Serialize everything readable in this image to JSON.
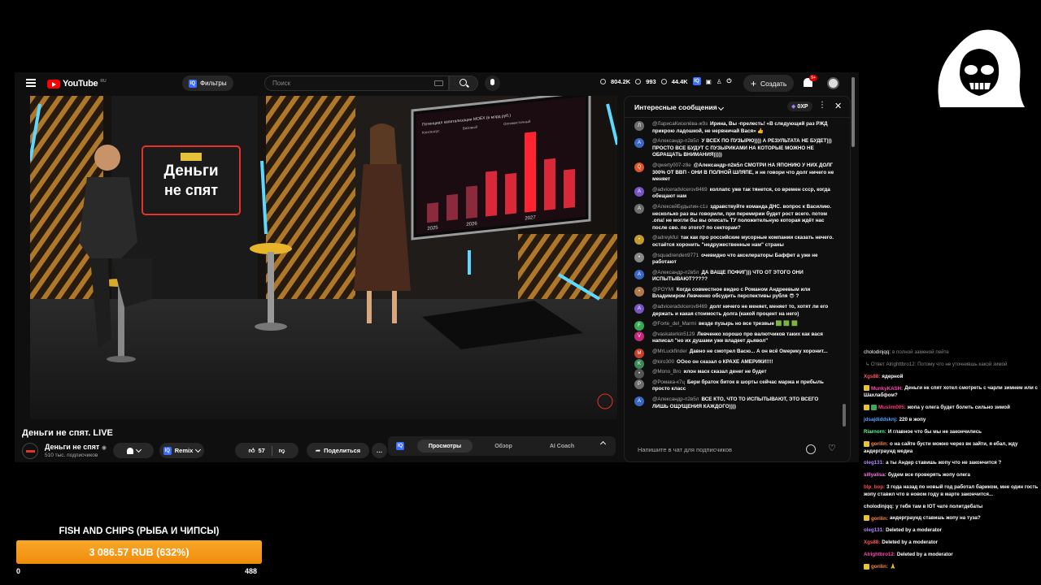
{
  "topbar": {
    "logo_text": "YouTube",
    "logo_country": "RU",
    "filter_label": "Фильтры",
    "search_placeholder": "Поиск",
    "stats": [
      "804.2K",
      "993",
      "44.4K"
    ],
    "create_label": "Создать",
    "notification_count": "9+"
  },
  "video": {
    "title": "Деньги не спят. LIVE",
    "studio_logo_line1": "Деньги",
    "studio_logo_line2": "не спят",
    "screen_chart_title": "Потенциал капитализации МОЕХ (в млрд руб.)",
    "screen_chart_legend": [
      "Консенсус",
      "Базовый",
      "Оптимистичный"
    ],
    "screen_chart": {
      "type": "bar",
      "categories": [
        "2025",
        "",
        "2026",
        "",
        "",
        "2027",
        "",
        ""
      ],
      "values": [
        18,
        24,
        30,
        42,
        38,
        75,
        48,
        36
      ]
    }
  },
  "channel": {
    "name": "Деньги не спят",
    "subscribers": "510 тыс. подписчиков",
    "remix_label": "Remix",
    "likes": "57",
    "share_label": "Поделиться"
  },
  "side_tabs": [
    "Просмотры",
    "Обзор",
    "AI Coach"
  ],
  "chat": {
    "header_title": "Интересные сообщения",
    "points": "0XP",
    "input_placeholder": "Напишите в чат для подписчиков",
    "messages": [
      {
        "initial": "Л",
        "color": "#6d6d6d",
        "author": "@ЛарисаКиселёва-ж9з",
        "text": "Ирина, Вы -прелесть! «В следующий раз РЖД прикрою ладошкой, не нервничай Вася» 👍"
      },
      {
        "initial": "А",
        "color": "#3a66c4",
        "author": "@Александр-п2в5л",
        "text": "У ВСЕХ ПО ПУЗЫРЮ)))) А РЕЗУЛЬТАТА НЕ БУДЕТ))) ПРОСТО ВСЕ БУДУТ С ПУЗЫРИКАМИ НА КОТОРЫЕ МОЖНО НЕ ОБРАЩАТЬ ВНИМАНИЯ)))))"
      },
      {
        "initial": "Q",
        "color": "#e0542a",
        "author": "@qwerty007-z8e",
        "text": "@Александр-п2в5л СМОТРИ НА ЯПОНИЮ У НИХ ДОЛГ 300% ОТ ВВП - ОНИ В ПОЛНОЙ ШЛЯПЕ, и не говори что долг ничего не меняет"
      },
      {
        "initial": "A",
        "color": "#7a55c4",
        "author": "@advicеradvicеrov8469",
        "text": "коллапс уже так тянется, со времен ссср, когда обещают нам"
      },
      {
        "initial": "А",
        "color": "#6d6d6d",
        "author": "@АлексейБудылин-с1з",
        "text": "здравствуйте команда ДНС. вопрос к Василию. несколько раз вы говорили, при перемирии будет рост всего. потом .опа! не могли бы вы описать ТУ положительную которая ждёт нас после сво. по этого? по секторам?"
      },
      {
        "initial": "•",
        "color": "#c49a2a",
        "author": "@adreykful",
        "text": "так как про российские мусорные компании сказать нечего. остаётся хоронить \"недружественные нам\" страны"
      },
      {
        "initial": "•",
        "color": "#888888",
        "author": "@squadrenden9771",
        "text": "очевидно что акселераторы Баффет а уже не работают"
      },
      {
        "initial": "А",
        "color": "#3a66c4",
        "author": "@Александр-п2в5л",
        "text": "ДА ВАЩЕ ПОФИГ))) ЧТО ОТ ЭТОГО ОНИ ИСПЫТЫВАЮТ?????"
      },
      {
        "initial": "•",
        "color": "#b07a4a",
        "author": "@POYMI",
        "text": "Когда совместное видео с Романом Андреевым или Владимиром Левченко обсудить перспективы рубля 😎 ?"
      },
      {
        "initial": "A",
        "color": "#7a55c4",
        "author": "@advicеradvicеrov8469",
        "text": "долг ничего не меняет, меняет то, хотят ли его держать и какая стоимость долга (какой процент на него)"
      },
      {
        "initial": "F",
        "color": "#3aa757",
        "author": "@Forte_del_Marmi",
        "text": "везде пузырь но все трезвые 🟩 🟩 🟩"
      },
      {
        "initial": "V",
        "color": "#c4287a",
        "author": "@vaskaterkin5129",
        "text": "Левченко хорошо про валютчиков таких как вася написал \"но их душами уже владеет дьявол\""
      },
      {
        "initial": "M",
        "color": "#c4402a",
        "author": "@MrLuckfinder",
        "text": "Давно не смотрел Васю... А он всё Омерику хоронит..."
      },
      {
        "initial": "K",
        "color": "#3a8a5a",
        "author": "@kiro300",
        "text": "ООоо он сказал о КРАХЕ АМЕРИКИ!!!!"
      },
      {
        "initial": "•",
        "color": "#555555",
        "author": "@Mono_Bro",
        "text": "илон маск сказал денег не будет"
      },
      {
        "initial": "Р",
        "color": "#6d6d6d",
        "author": "@Ромака-к7ц",
        "text": "Бери браток биток в шорты сейчас маржа и прибыль просто класс"
      },
      {
        "initial": "А",
        "color": "#3a66c4",
        "author": "@Александр-п2в5л",
        "text": "ВСЕ КТО, ЧТО ТО ИСПЫТЫВАЮТ, ЭТО ВСЕГО ЛИШЬ ОЩУЩЕНИЯ КАЖДОГО))))"
      }
    ]
  },
  "twitch_chat": [
    {
      "user": "cholodinjqq:",
      "color": "#ffffff",
      "text": "в полной заменой пейте",
      "faded": true,
      "badge": ""
    },
    {
      "user": "",
      "color": "#aaaaaa",
      "text": "↳ Ответ Alrighttbro12: Потому что не уточнившь какой зимой",
      "faded": true,
      "badge": ""
    },
    {
      "user": "Xgs88:",
      "color": "#ff5a5a",
      "text": "ядерной",
      "faded": false,
      "badge": ""
    },
    {
      "user": "MunkyKASH:",
      "color": "#ff4ab4",
      "text": "Деньги нк спят хотел смотреть с чарли зимнем или с Шахлабфом?",
      "faded": false,
      "badge": "y"
    },
    {
      "user": "Muslim005:",
      "color": "#ff3d7f",
      "text": "жопа у олега будет болеть сильно зимой",
      "faded": false,
      "badge": "yg"
    },
    {
      "user": "jdsajdiddsknj:",
      "color": "#5aa0ff",
      "text": "220 в жопу",
      "faded": false,
      "badge": ""
    },
    {
      "user": "Riarnorn:",
      "color": "#5aff8a",
      "text": "И главное что бы мы не закончились",
      "faded": false,
      "badge": ""
    },
    {
      "user": "gorilin:",
      "color": "#ff8a3d",
      "text": "о на сайте бусти можно через вк зайти, я ебал, жду андерграунд медиа",
      "faded": false,
      "badge": "y"
    },
    {
      "user": "oleg131:",
      "color": "#b28aff",
      "text": "а ты Андер ставишь жопу что не закончится ?",
      "faded": false,
      "badge": ""
    },
    {
      "user": "sillyalisa:",
      "color": "#ff7adf",
      "text": "будем все проверять жопу олега",
      "faded": false,
      "badge": ""
    },
    {
      "user": "blp_bop:",
      "color": "#ff4a4a",
      "text": "3 года назад по новый год работал бариком, мне один гость жопу ставил что в новом году в марте закончится...",
      "faded": false,
      "badge": ""
    },
    {
      "user": "cholodinjqq:",
      "color": "#ffffff",
      "text": "у тебя там в IOT чате политдебаты",
      "faded": false,
      "badge": ""
    },
    {
      "user": "gorilin:",
      "color": "#ff8a3d",
      "text": "андерграунд ставишь жопу на туза?",
      "faded": false,
      "badge": "y"
    },
    {
      "user": "oleg131:",
      "color": "#b28aff",
      "text": "Deleted by a moderator",
      "faded": false,
      "badge": ""
    },
    {
      "user": "Xgs88:",
      "color": "#ff5a5a",
      "text": "Deleted by a moderator",
      "faded": false,
      "badge": ""
    },
    {
      "user": "Alrightbro12:",
      "color": "#ff4ab4",
      "text": "Deleted by a moderator",
      "faded": false,
      "badge": ""
    },
    {
      "user": "gorilin:",
      "color": "#ff8a3d",
      "text": "🙏",
      "faded": false,
      "badge": "y"
    }
  ],
  "goal": {
    "title": "FISH AND CHIPS (РЫБА И ЧИПСЫ)",
    "value_text": "3 086.57 RUB (632%)",
    "min": "0",
    "max": "488",
    "progress_fraction": 1.0,
    "color": "#f39c12"
  }
}
